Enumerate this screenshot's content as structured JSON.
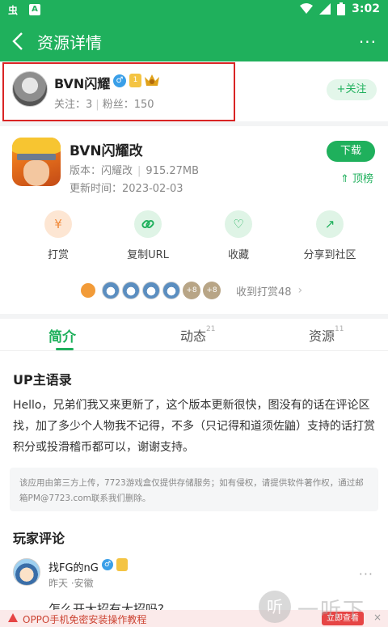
{
  "status_bar": {
    "app_glyph": "虫",
    "a_glyph": "A",
    "time": "3:02"
  },
  "app_bar": {
    "title": "资源详情",
    "more": "···"
  },
  "author": {
    "name": "BVN闪耀",
    "gender": "♂",
    "medal": "1",
    "following_label": "关注：",
    "following": "3",
    "followers_label": "粉丝：",
    "followers": "150",
    "follow_button": "+关注"
  },
  "game": {
    "title": "BVN闪耀改",
    "version_label": "版本：",
    "version": "闪耀改",
    "size": "915.27MB",
    "updated_label": "更新时间：",
    "updated": "2023-02-03",
    "download_button": "下载",
    "rank_button": "顶榜"
  },
  "actions": [
    {
      "label": "打赏",
      "icon": "yen-icon",
      "glyph": "¥"
    },
    {
      "label": "复制URL",
      "icon": "link-icon",
      "glyph": "🔗"
    },
    {
      "label": "收藏",
      "icon": "heart-icon",
      "glyph": "♡"
    },
    {
      "label": "分享到社区",
      "icon": "share-icon",
      "glyph": "↗"
    }
  ],
  "tips": {
    "plus_a": "+8",
    "plus_b": "+8",
    "text": "收到打赏48",
    "chevron": "›"
  },
  "tabs": [
    {
      "label": "简介",
      "count": ""
    },
    {
      "label": "动态",
      "count": "21"
    },
    {
      "label": "资源",
      "count": "11"
    }
  ],
  "intro": {
    "heading": "UP主语录",
    "body": "Hello，兄弟们我又来更新了，这个版本更新很快，图没有的话在评论区找，加了多少个人物我不记得，不多（只记得和道须佐鼬）支持的话打赏积分或投滑稽币都可以，谢谢支持。",
    "notice": "该应用由第三方上传，7723游戏盒仅提供存储服务；如有侵权，请提供软件著作权，通过邮箱PM@7723.com联系我们删除。"
  },
  "comments": {
    "heading": "玩家评论",
    "items": [
      {
        "user": "找FG的nG",
        "meta": "昨天 ·安徽",
        "text": "怎么开大招有大招吗?"
      }
    ]
  },
  "banner": {
    "text": "OPPO手机免密安装操作教程",
    "button": "立即查看",
    "close": "×"
  },
  "watermark": {
    "glyph": "听",
    "text": "一听下载"
  },
  "colors": {
    "brand": "#1fb05c",
    "highlight": "#d92424"
  }
}
